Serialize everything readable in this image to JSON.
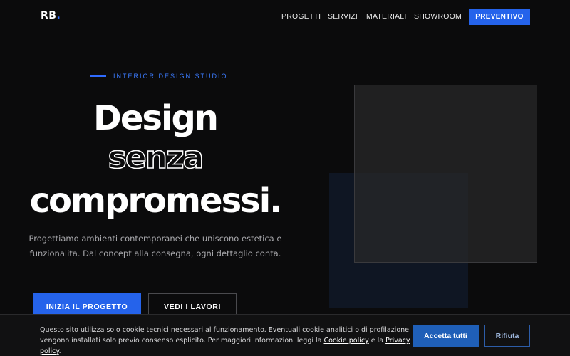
{
  "header": {
    "logo_text": "RB",
    "logo_dot": ".",
    "nav": [
      "PROGETTI",
      "SERVIZI",
      "MATERIALI",
      "SHOWROOM"
    ],
    "cta_label": "PREVENTIVO"
  },
  "hero": {
    "eyebrow": "INTERIOR DESIGN STUDIO",
    "headline_line1": "Design",
    "headline_line2": "senza",
    "headline_line3": "compromessi.",
    "lead": "Progettiamo ambienti contemporanei che uniscono estetica e funzionalita. Dal concept alla consegna, ogni dettaglio conta.",
    "primary_button": "INIZIA IL PROGETTO",
    "secondary_button": "VEDI I LAVORI"
  },
  "cookie_banner": {
    "text_before": "Questo sito utilizza solo cookie tecnici necessari al funzionamento. Eventuali cookie analitici o di profilazione vengono installati solo previo consenso esplicito. Per maggiori informazioni leggi la ",
    "cookie_policy_link": "Cookie policy",
    "text_middle": " e la ",
    "privacy_policy_link": "Privacy policy",
    "text_after": ".",
    "accept_label": "Accetta tutti",
    "refuse_label": "Rifiuta"
  },
  "colors": {
    "accent": "#2563eb",
    "background": "#0b0b0c"
  }
}
